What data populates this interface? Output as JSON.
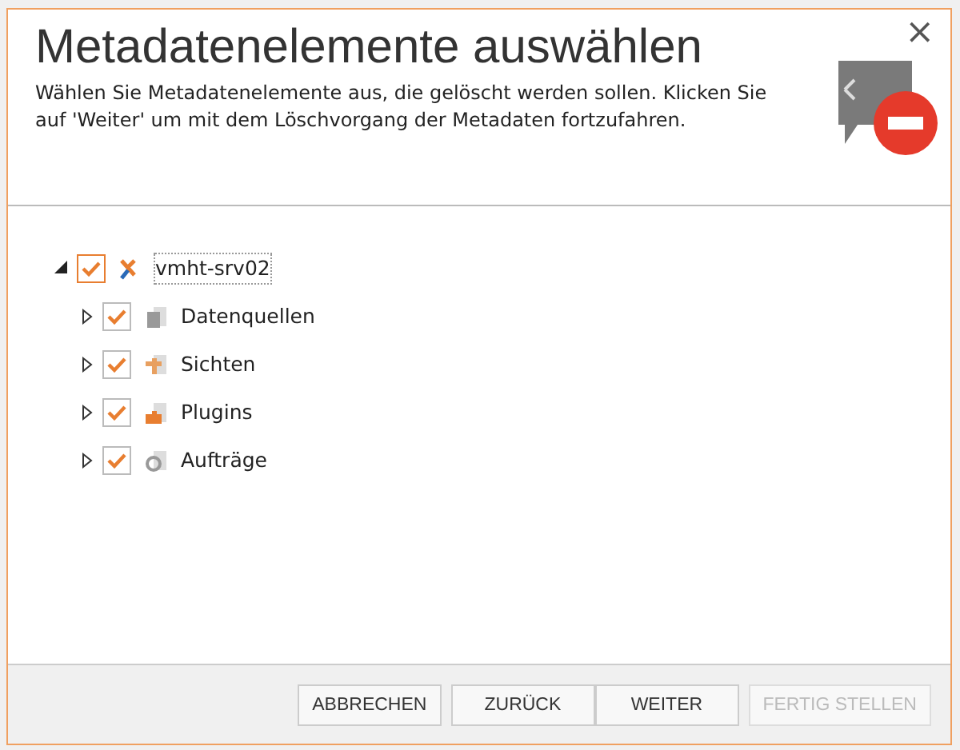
{
  "dialog": {
    "title": "Metadatenelemente auswählen",
    "description": "Wählen Sie Metadatenelemente aus, die gelöscht werden sollen. Klicken Sie auf 'Weiter' um mit dem Löschvorgang der Metadaten fortzufahren.",
    "close": "×"
  },
  "tree": [
    {
      "label": "vmht-srv02",
      "kind": "server",
      "checked": true,
      "expanded": true,
      "selected": true,
      "children": [
        {
          "label": "Datenquellen",
          "kind": "datasource",
          "checked": true,
          "expanded": false,
          "selected": false
        },
        {
          "label": "Sichten",
          "kind": "view",
          "checked": true,
          "expanded": false,
          "selected": false
        },
        {
          "label": "Plugins",
          "kind": "plugin",
          "checked": true,
          "expanded": false,
          "selected": false
        },
        {
          "label": "Aufträge",
          "kind": "job",
          "checked": true,
          "expanded": false,
          "selected": false
        }
      ]
    }
  ],
  "buttons": [
    {
      "label": "ABBRECHEN",
      "disabled": false
    },
    {
      "label": "ZURÜCK",
      "disabled": false
    },
    {
      "label": "WEITER",
      "disabled": false
    },
    {
      "label": "FERTIG STELLEN",
      "disabled": true
    }
  ]
}
